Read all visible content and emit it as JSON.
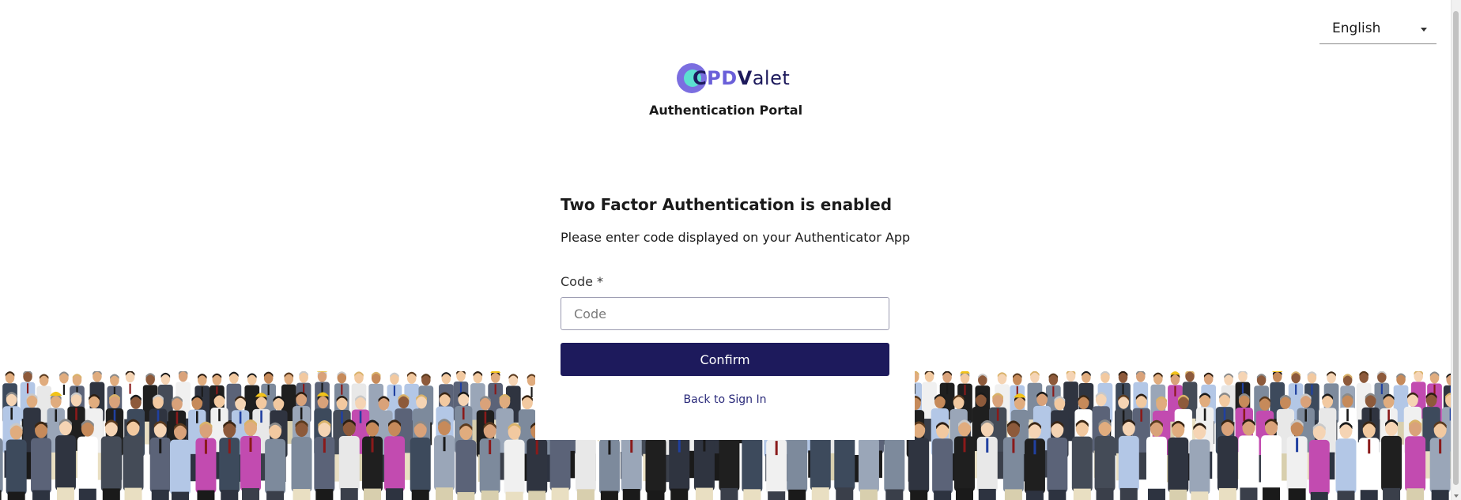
{
  "language_selector": {
    "value": "English",
    "icon": "caret-down-icon"
  },
  "logo": {
    "c": "C",
    "pd": "PD",
    "v": "V",
    "alet": "alet",
    "colors": {
      "mark_outer": "#7b6ee0",
      "mark_inner": "#5ce0d0",
      "text_dark": "#1d1a5c",
      "text_accent": "#6a5fd9"
    }
  },
  "portal_title": "Authentication Portal",
  "form": {
    "heading": "Two Factor Authentication is enabled",
    "instruction": "Please enter code displayed on your Authenticator App",
    "code_label": "Code *",
    "code_placeholder": "Code",
    "code_value": "",
    "confirm_label": "Confirm",
    "back_link": "Back to Sign In"
  },
  "colors": {
    "primary": "#1d1a5c",
    "link": "#2a2a7a",
    "background": "#ffffff"
  }
}
